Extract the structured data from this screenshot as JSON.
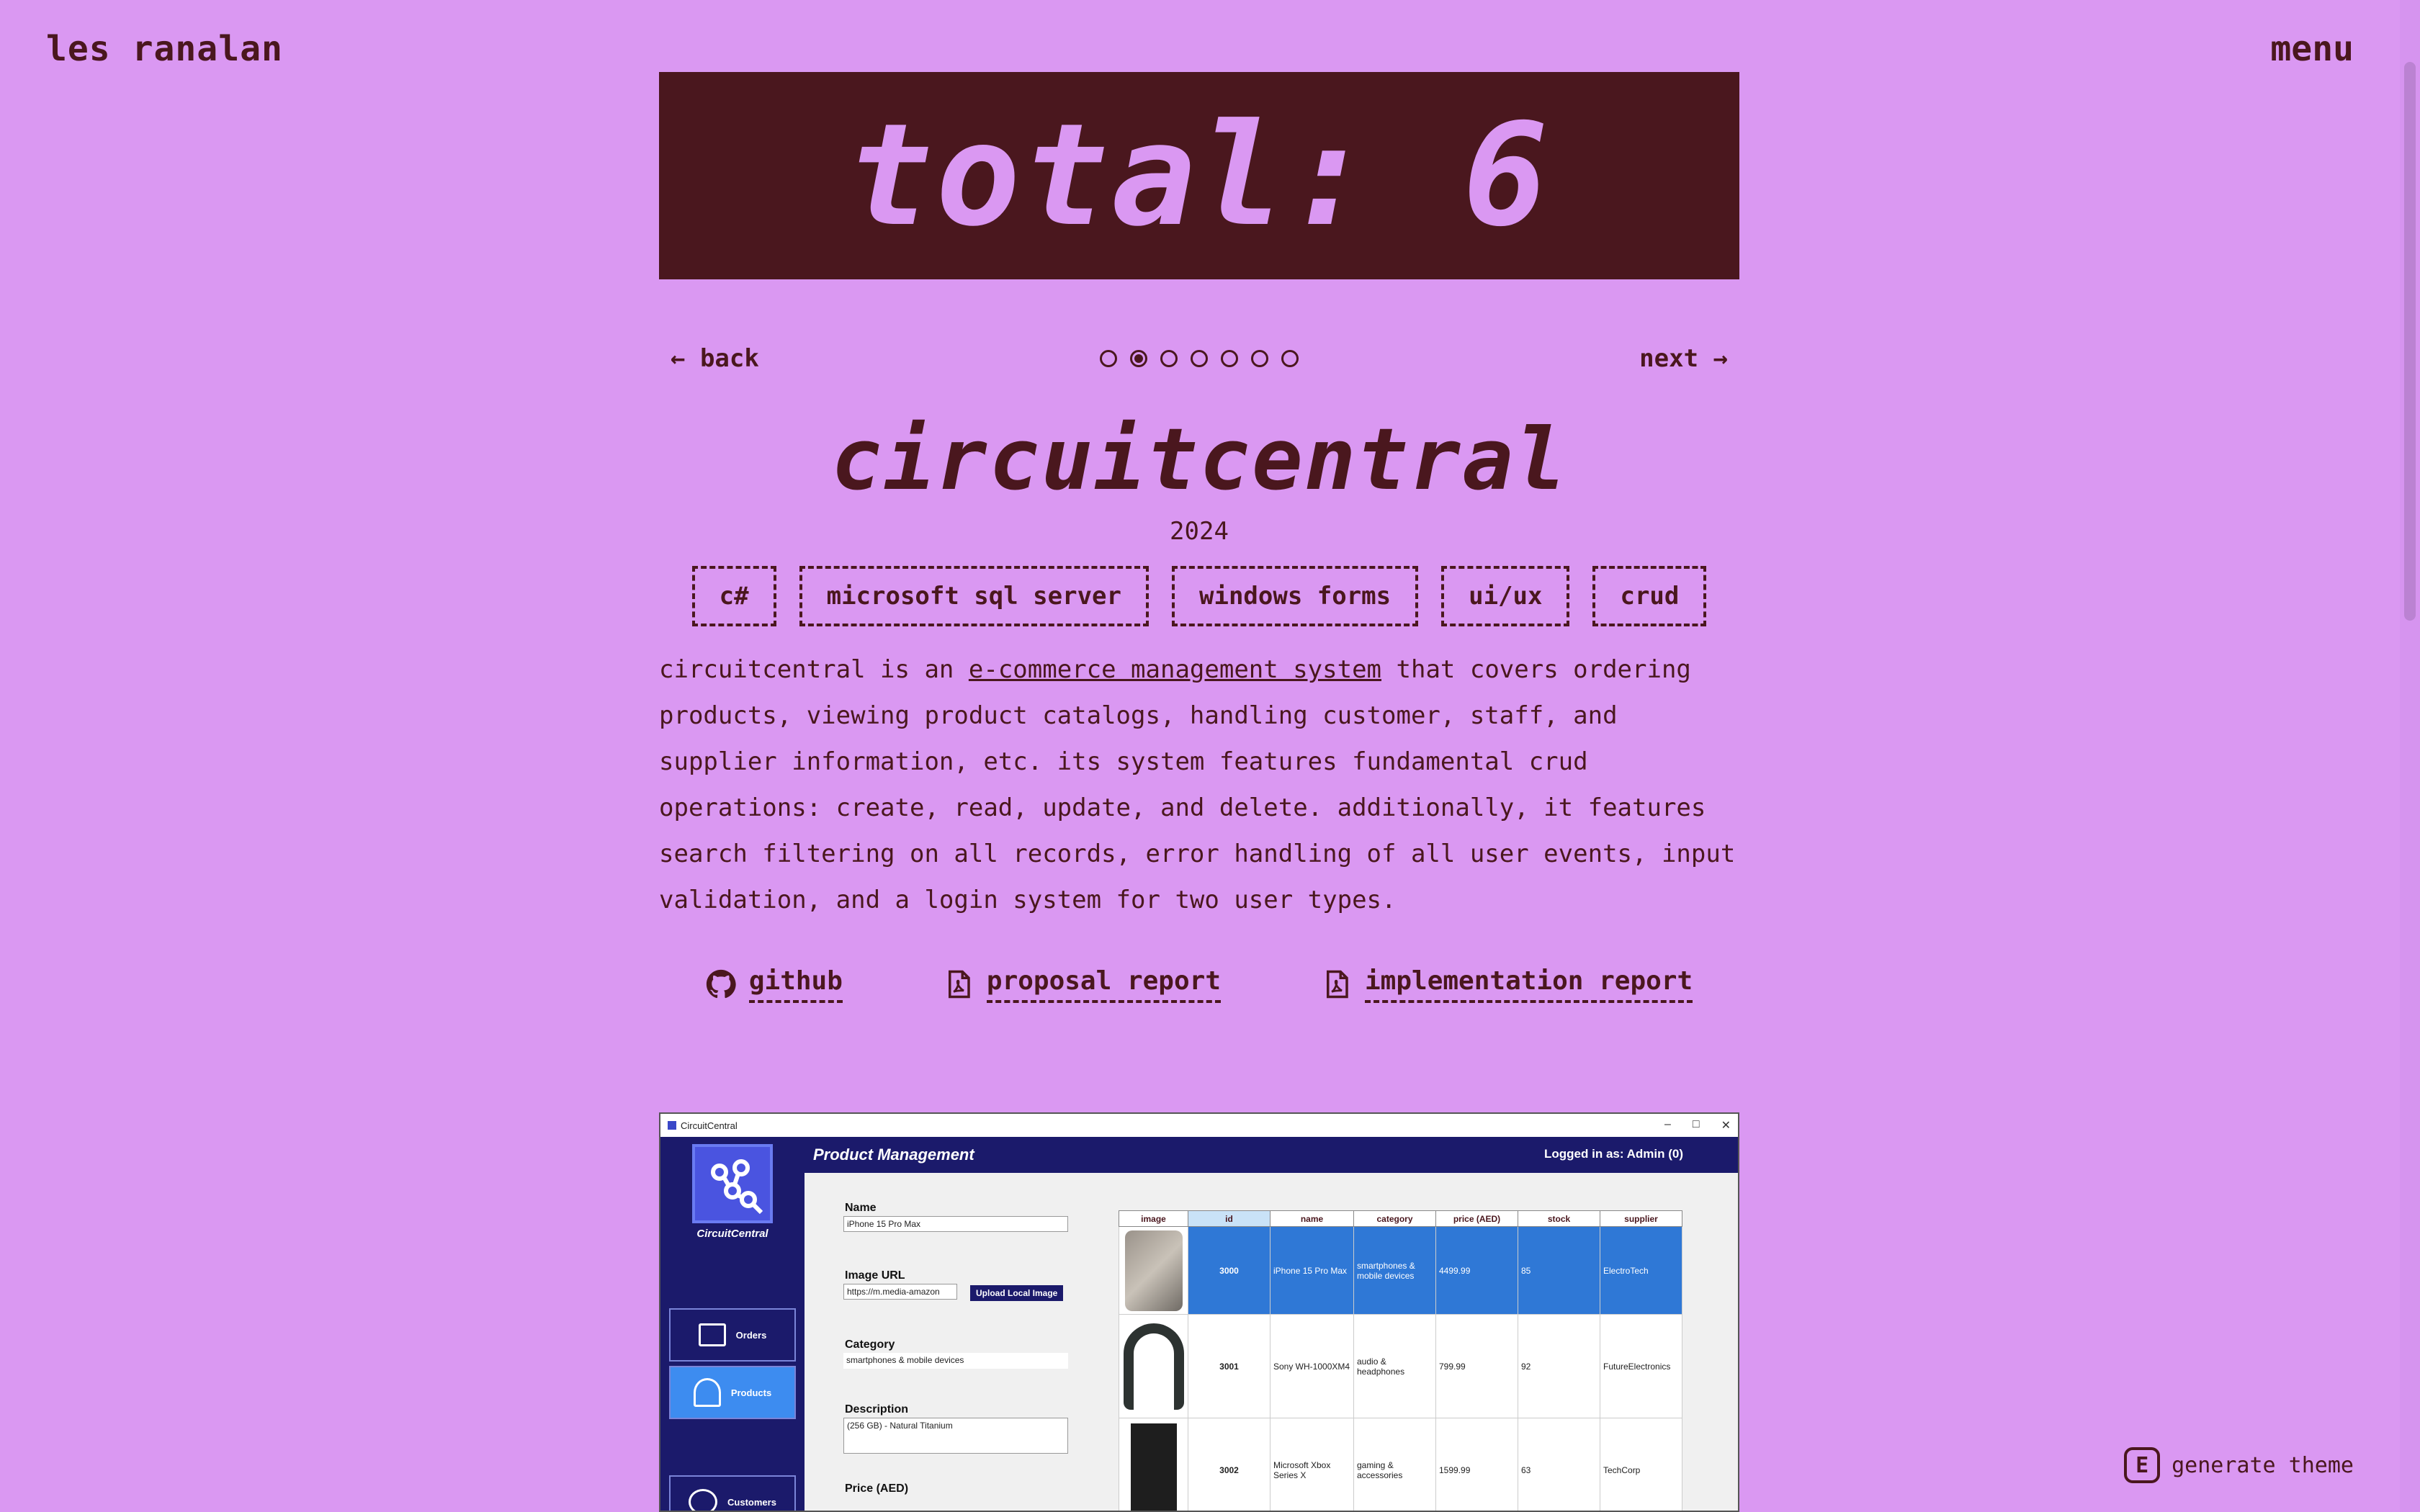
{
  "header": {
    "site_name": "les ranalan",
    "menu_label": "menu"
  },
  "banner": {
    "text": "total: 6"
  },
  "pager": {
    "back_label": "← back",
    "next_label": "next →",
    "count": 7,
    "active_index": 1
  },
  "project": {
    "title": "circuitcentral",
    "year": "2024",
    "tags": [
      "c#",
      "microsoft sql server",
      "windows forms",
      "ui/ux",
      "crud"
    ],
    "description_pre": "circuitcentral is an ",
    "description_link": "e-commerce management system",
    "description_post": " that covers ordering products, viewing product catalogs, handling customer, staff, and supplier information, etc. its system features fundamental crud operations: create, read, update, and delete. additionally, it features search filtering on all records, error handling of all user events, input validation, and a login system for two user types.",
    "links": [
      {
        "label": "github",
        "icon": "github-icon"
      },
      {
        "label": "proposal report",
        "icon": "pdf-icon"
      },
      {
        "label": "implementation report",
        "icon": "pdf-icon"
      }
    ]
  },
  "preview": {
    "window_title": "CircuitCentral",
    "controls": [
      "–",
      "□",
      "✕"
    ],
    "app_title": "Product Management",
    "logged_in": "Logged in as: Admin (0)",
    "logo_text": "CircuitCentral",
    "sidebar": [
      "Orders",
      "Products",
      "Customers"
    ],
    "form": {
      "name_label": "Name",
      "name_value": "iPhone 15 Pro Max",
      "image_url_label": "Image URL",
      "image_url_value": "https://m.media-amazon",
      "upload_button": "Upload Local Image",
      "category_label": "Category",
      "category_value": "smartphones & mobile devices",
      "description_label": "Description",
      "description_value": "(256 GB) - Natural Titanium",
      "price_label": "Price (AED)"
    },
    "grid": {
      "columns": [
        "image",
        "id",
        "name",
        "category",
        "price (AED)",
        "stock",
        "supplier"
      ],
      "rows": [
        [
          "",
          "3000",
          "iPhone 15 Pro Max",
          "smartphones & mobile devices",
          "4499.99",
          "85",
          "ElectroTech"
        ],
        [
          "",
          "3001",
          "Sony WH-1000XM4",
          "audio & headphones",
          "799.99",
          "92",
          "FutureElectronics"
        ],
        [
          "",
          "3002",
          "Microsoft Xbox Series X",
          "gaming & accessories",
          "1599.99",
          "63",
          "TechCorp"
        ]
      ]
    }
  },
  "footer": {
    "generate_theme_label": "generate theme",
    "generate_theme_icon_letter": "E"
  },
  "colors": {
    "background": "#da98f2",
    "accent": "#4a171e",
    "app_navy": "#1b1a6b",
    "app_selected": "#2f78d6"
  }
}
